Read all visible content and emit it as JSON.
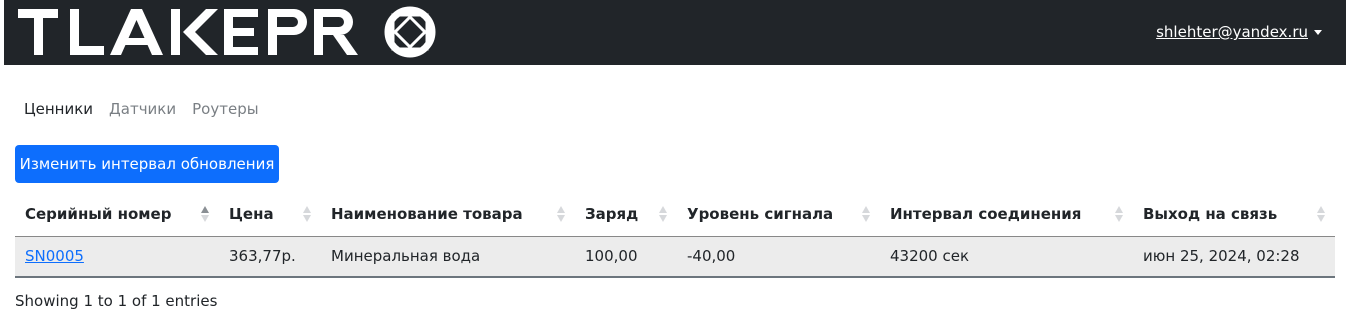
{
  "header": {
    "logo_text": "TLAKEPRO",
    "user_email": "shlehter@yandex.ru"
  },
  "tabs": [
    {
      "label": "Ценники",
      "active": true
    },
    {
      "label": "Датчики",
      "active": false
    },
    {
      "label": "Роутеры",
      "active": false
    }
  ],
  "actions": {
    "change_interval_label": "Изменить интервал обновления"
  },
  "table": {
    "columns": [
      "Серийный номер",
      "Цена",
      "Наименование товара",
      "Заряд",
      "Уровень сигнала",
      "Интервал соединения",
      "Выход на связь"
    ],
    "sorted_column": 0,
    "rows": [
      [
        "SN0005",
        "363,77р.",
        "Минеральная вода",
        "100,00",
        "-40,00",
        "43200 сек",
        "июн 25, 2024, 02:28"
      ]
    ]
  },
  "footer": {
    "info": "Showing 1 to 1 of 1 entries"
  },
  "colors": {
    "navbar_bg": "#212529",
    "primary": "#0d6efd",
    "row_bg": "#ececec"
  }
}
